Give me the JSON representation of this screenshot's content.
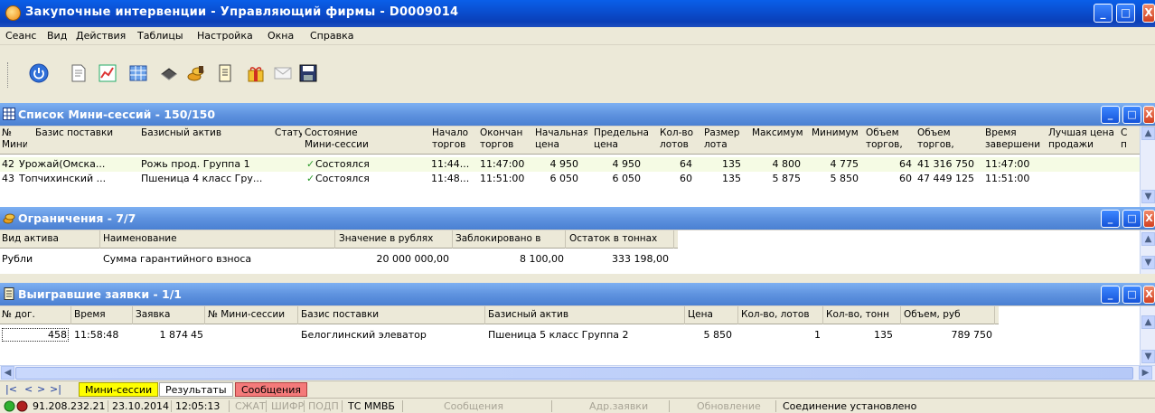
{
  "window": {
    "title": "Закупочные интервенции - Управляющий фирмы - D0009014",
    "controls": {
      "minimize": "_",
      "maximize": "□",
      "close": "X"
    }
  },
  "menu": [
    "Сеанс",
    "Вид",
    "Действия",
    "Таблицы",
    "Настройка",
    "Окна",
    "Справка"
  ],
  "toolbar": {
    "icons": [
      "power-icon",
      "document-icon",
      "chart-icon",
      "table-icon",
      "book-icon",
      "coins-icon",
      "page-icon",
      "gift-icon",
      "mail-icon",
      "save-icon"
    ]
  },
  "mini_sessions": {
    "title": "Список Мини-сессий - 150/150",
    "columns": [
      [
        "№",
        "Мини"
      ],
      [
        "Базис поставки",
        ""
      ],
      [
        "Базисный актив",
        ""
      ],
      [
        "Статус",
        ""
      ],
      [
        "Состояние",
        "Мини-сессии"
      ],
      [
        "Начало",
        "торгов"
      ],
      [
        "Окончани",
        "торгов"
      ],
      [
        "Начальная",
        "цена"
      ],
      [
        "Предельна",
        "цена"
      ],
      [
        "Кол-во",
        "лотов"
      ],
      [
        "Размер",
        "лота"
      ],
      [
        "Максимум",
        ""
      ],
      [
        "Минимум",
        ""
      ],
      [
        "Объем",
        "торгов,"
      ],
      [
        "Объем",
        "торгов,"
      ],
      [
        "Время",
        "завершени"
      ],
      [
        "Лучшая цена",
        "продажи"
      ],
      [
        "С",
        "п"
      ]
    ],
    "rows": [
      {
        "cells": [
          "42",
          "Урожай(Омска...",
          "Рожь прод. Группа 1",
          "",
          "Состоялся",
          "11:44...",
          "11:47:00",
          "4 950",
          "4 950",
          "64",
          "135",
          "4 800",
          "4 775",
          "64",
          "41 316 750",
          "11:47:00",
          "",
          ""
        ]
      },
      {
        "cells": [
          "43",
          "Топчихинский ...",
          "Пшеница 4 класс Гру...",
          "",
          "Состоялся",
          "11:48...",
          "11:51:00",
          "6 050",
          "6 050",
          "60",
          "135",
          "5 875",
          "5 850",
          "60",
          "47 449 125",
          "11:51:00",
          "",
          ""
        ]
      }
    ],
    "state_check": "✓"
  },
  "limits": {
    "title": "Ограничения - 7/7",
    "columns": [
      "Вид актива",
      "Наименование",
      "Значение в рублях",
      "Заблокировано в",
      "Остаток в тоннах"
    ],
    "rows": [
      {
        "cells": [
          "Рубли",
          "Сумма гарантийного взноса",
          "20 000 000,00",
          "8 100,00",
          "333 198,00"
        ]
      }
    ]
  },
  "won_bids": {
    "title": "Выигравшие заявки - 1/1",
    "columns": [
      "№ дог.",
      "Время",
      "Заявка",
      "№ Мини-сессии",
      "Базис поставки",
      "Базисный актив",
      "Цена",
      "Кол-во, лотов",
      "Кол-во, тонн",
      "Объем, руб"
    ],
    "rows": [
      {
        "cells": [
          "458",
          "11:58:48",
          "1 874",
          "45",
          "Белоглинский элеватор",
          "Пшеница 5 класс Группа 2",
          "5 850",
          "1",
          "135",
          "789 750"
        ]
      }
    ]
  },
  "bottom_tabs": {
    "nav": [
      "|<",
      "<",
      ">",
      ">|"
    ],
    "tabs": [
      "Мини-сессии",
      "Результаты",
      "Сообщения"
    ],
    "colors": {
      "mini": "#ffff00",
      "results": "#ffffff",
      "messages": "#f47a7a"
    }
  },
  "status": {
    "ip": "91.208.232.21",
    "date": "23.10.2014",
    "time": "12:05:13",
    "flags": [
      "СЖАТ",
      "ШИФР",
      "ПОДП"
    ],
    "exchange": "ТС ММВБ",
    "messages": "Сообщения",
    "addr": "Адр.заявки",
    "update": "Обновление",
    "connection": "Соединение установлено"
  }
}
